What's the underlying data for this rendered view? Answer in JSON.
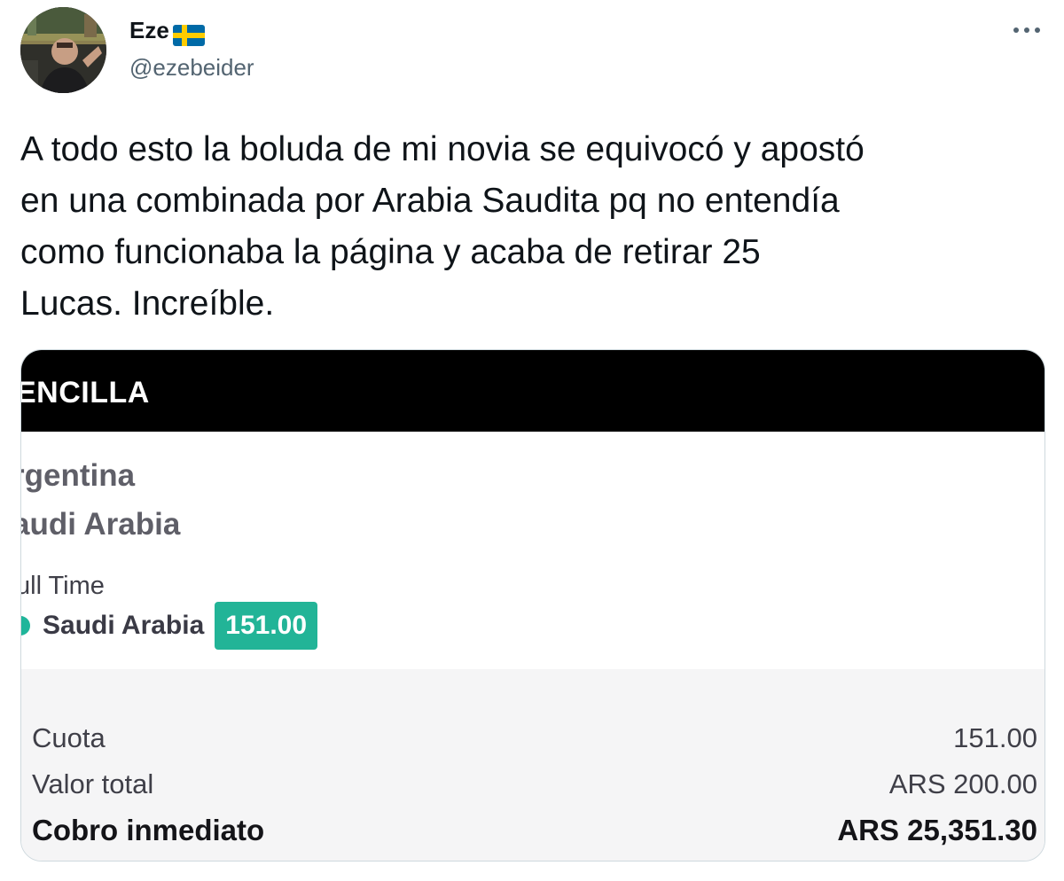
{
  "author": {
    "name": "Eze",
    "flag_icon": "sweden-flag-icon",
    "handle": "@ezebeider"
  },
  "tweet": {
    "text": "A todo esto la boluda de mi novia se equivocó y apostó\nen una combinada por Arabia Saudita pq no entendía\ncomo funcionaba la página y acaba de retirar 25\nLucas. Increíble."
  },
  "bet_slip": {
    "header_title": "ENCILLA",
    "teams": [
      "rgentina",
      "audi Arabia"
    ],
    "market": "ull Time",
    "selection": {
      "label": "Saudi Arabia",
      "odds": "151.00"
    },
    "summary": [
      {
        "label": "Cuota",
        "value": "151.00"
      },
      {
        "label": "Valor total",
        "value": "ARS 200.00"
      },
      {
        "label": "Cobro inmediato",
        "value": "ARS 25,351.30"
      }
    ],
    "accent_color": "#22b497"
  },
  "icons": {
    "more": "more-dots-icon"
  }
}
